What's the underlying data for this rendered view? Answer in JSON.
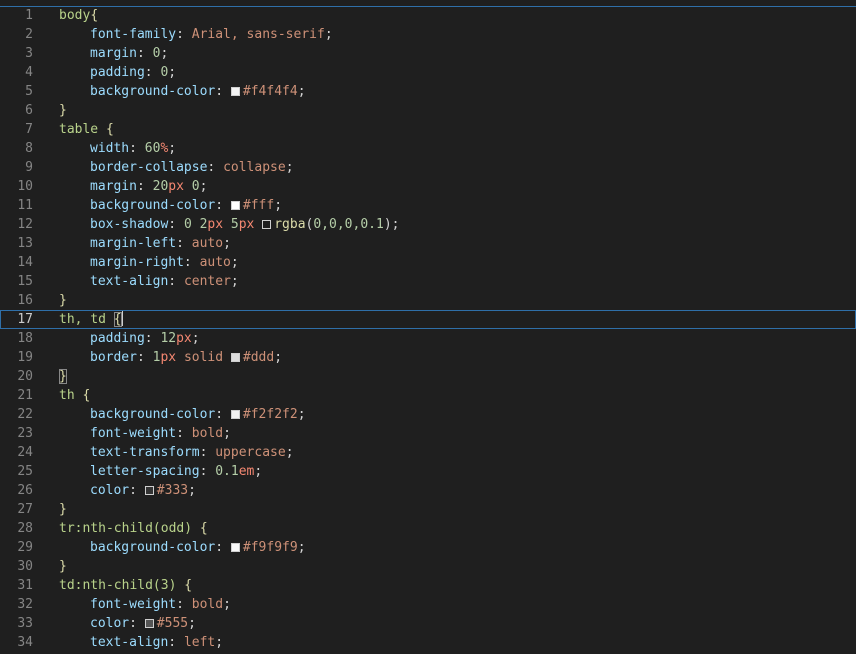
{
  "editor": {
    "current_line": 17,
    "lines": [
      {
        "n": "1",
        "indent": false,
        "tokens": [
          {
            "t": "body",
            "c": "sel"
          },
          {
            "t": "{",
            "c": "brace"
          }
        ]
      },
      {
        "n": "2",
        "indent": true,
        "tokens": [
          {
            "t": "font-family",
            "c": "prop"
          },
          {
            "t": ": ",
            "c": "plain"
          },
          {
            "t": "Arial, sans-serif",
            "c": "val"
          },
          {
            "t": ";",
            "c": "plain"
          }
        ]
      },
      {
        "n": "3",
        "indent": true,
        "tokens": [
          {
            "t": "margin",
            "c": "prop"
          },
          {
            "t": ": ",
            "c": "plain"
          },
          {
            "t": "0",
            "c": "num-v"
          },
          {
            "t": ";",
            "c": "plain"
          }
        ]
      },
      {
        "n": "4",
        "indent": true,
        "tokens": [
          {
            "t": "padding",
            "c": "prop"
          },
          {
            "t": ": ",
            "c": "plain"
          },
          {
            "t": "0",
            "c": "num-v"
          },
          {
            "t": ";",
            "c": "plain"
          }
        ]
      },
      {
        "n": "5",
        "indent": true,
        "tokens": [
          {
            "t": "background-color",
            "c": "prop"
          },
          {
            "t": ": ",
            "c": "plain"
          },
          {
            "t": "#f4f4f4",
            "c": "hexv",
            "swatch": "#f4f4f4"
          },
          {
            "t": ";",
            "c": "plain"
          }
        ]
      },
      {
        "n": "6",
        "indent": false,
        "tokens": [
          {
            "t": "}",
            "c": "brace"
          }
        ]
      },
      {
        "n": "7",
        "indent": false,
        "tokens": [
          {
            "t": "table ",
            "c": "sel"
          },
          {
            "t": "{",
            "c": "brace"
          }
        ]
      },
      {
        "n": "8",
        "indent": true,
        "tokens": [
          {
            "t": "width",
            "c": "prop"
          },
          {
            "t": ": ",
            "c": "plain"
          },
          {
            "t": "60",
            "c": "num-v"
          },
          {
            "t": "%",
            "c": "unit"
          },
          {
            "t": ";",
            "c": "plain"
          }
        ]
      },
      {
        "n": "9",
        "indent": true,
        "tokens": [
          {
            "t": "border-collapse",
            "c": "prop"
          },
          {
            "t": ": ",
            "c": "plain"
          },
          {
            "t": "collapse",
            "c": "val"
          },
          {
            "t": ";",
            "c": "plain"
          }
        ]
      },
      {
        "n": "10",
        "indent": true,
        "tokens": [
          {
            "t": "margin",
            "c": "prop"
          },
          {
            "t": ": ",
            "c": "plain"
          },
          {
            "t": "20",
            "c": "num-v"
          },
          {
            "t": "px",
            "c": "unit"
          },
          {
            "t": " ",
            "c": "plain"
          },
          {
            "t": "0",
            "c": "num-v"
          },
          {
            "t": ";",
            "c": "plain"
          }
        ]
      },
      {
        "n": "11",
        "indent": true,
        "tokens": [
          {
            "t": "background-color",
            "c": "prop"
          },
          {
            "t": ": ",
            "c": "plain"
          },
          {
            "t": "#fff",
            "c": "hexv",
            "swatch": "#ffffff"
          },
          {
            "t": ";",
            "c": "plain"
          }
        ]
      },
      {
        "n": "12",
        "indent": true,
        "tokens": [
          {
            "t": "box-shadow",
            "c": "prop"
          },
          {
            "t": ": ",
            "c": "plain"
          },
          {
            "t": "0",
            "c": "num-v"
          },
          {
            "t": " ",
            "c": "plain"
          },
          {
            "t": "2",
            "c": "num-v"
          },
          {
            "t": "px",
            "c": "unit"
          },
          {
            "t": " ",
            "c": "plain"
          },
          {
            "t": "5",
            "c": "num-v"
          },
          {
            "t": "px",
            "c": "unit"
          },
          {
            "t": " ",
            "c": "plain"
          },
          {
            "t": "rgba",
            "c": "brace",
            "swatch": "#1f1f1f"
          },
          {
            "t": "(",
            "c": "plain"
          },
          {
            "t": "0,0,0,0.1",
            "c": "num-v"
          },
          {
            "t": ");",
            "c": "plain"
          }
        ]
      },
      {
        "n": "13",
        "indent": true,
        "tokens": [
          {
            "t": "margin-left",
            "c": "prop"
          },
          {
            "t": ": ",
            "c": "plain"
          },
          {
            "t": "auto",
            "c": "val"
          },
          {
            "t": ";",
            "c": "plain"
          }
        ]
      },
      {
        "n": "14",
        "indent": true,
        "tokens": [
          {
            "t": "margin-right",
            "c": "prop"
          },
          {
            "t": ": ",
            "c": "plain"
          },
          {
            "t": "auto",
            "c": "val"
          },
          {
            "t": ";",
            "c": "plain"
          }
        ]
      },
      {
        "n": "15",
        "indent": true,
        "tokens": [
          {
            "t": "text-align",
            "c": "prop"
          },
          {
            "t": ": ",
            "c": "plain"
          },
          {
            "t": "center",
            "c": "val"
          },
          {
            "t": ";",
            "c": "plain"
          }
        ]
      },
      {
        "n": "16",
        "indent": false,
        "tokens": [
          {
            "t": "}",
            "c": "brace"
          }
        ]
      },
      {
        "n": "17",
        "indent": false,
        "tokens": [
          {
            "t": "th, td ",
            "c": "sel"
          },
          {
            "t": "{",
            "c": "brace",
            "hl": true
          }
        ]
      },
      {
        "n": "18",
        "indent": true,
        "tokens": [
          {
            "t": "padding",
            "c": "prop"
          },
          {
            "t": ": ",
            "c": "plain"
          },
          {
            "t": "12",
            "c": "num-v"
          },
          {
            "t": "px",
            "c": "unit"
          },
          {
            "t": ";",
            "c": "plain"
          }
        ]
      },
      {
        "n": "19",
        "indent": true,
        "tokens": [
          {
            "t": "border",
            "c": "prop"
          },
          {
            "t": ": ",
            "c": "plain"
          },
          {
            "t": "1",
            "c": "num-v"
          },
          {
            "t": "px",
            "c": "unit"
          },
          {
            "t": " ",
            "c": "plain"
          },
          {
            "t": "solid",
            "c": "val"
          },
          {
            "t": " ",
            "c": "plain"
          },
          {
            "t": "#ddd",
            "c": "hexv",
            "swatch": "#dddddd"
          },
          {
            "t": ";",
            "c": "plain"
          }
        ]
      },
      {
        "n": "20",
        "indent": false,
        "tokens": [
          {
            "t": "}",
            "c": "brace",
            "hl": true
          }
        ]
      },
      {
        "n": "21",
        "indent": false,
        "tokens": [
          {
            "t": "th ",
            "c": "sel"
          },
          {
            "t": "{",
            "c": "brace"
          }
        ]
      },
      {
        "n": "22",
        "indent": true,
        "tokens": [
          {
            "t": "background-color",
            "c": "prop"
          },
          {
            "t": ": ",
            "c": "plain"
          },
          {
            "t": "#f2f2f2",
            "c": "hexv",
            "swatch": "#f2f2f2"
          },
          {
            "t": ";",
            "c": "plain"
          }
        ]
      },
      {
        "n": "23",
        "indent": true,
        "tokens": [
          {
            "t": "font-weight",
            "c": "prop"
          },
          {
            "t": ": ",
            "c": "plain"
          },
          {
            "t": "bold",
            "c": "val"
          },
          {
            "t": ";",
            "c": "plain"
          }
        ]
      },
      {
        "n": "24",
        "indent": true,
        "tokens": [
          {
            "t": "text-transform",
            "c": "prop"
          },
          {
            "t": ": ",
            "c": "plain"
          },
          {
            "t": "uppercase",
            "c": "val"
          },
          {
            "t": ";",
            "c": "plain"
          }
        ]
      },
      {
        "n": "25",
        "indent": true,
        "tokens": [
          {
            "t": "letter-spacing",
            "c": "prop"
          },
          {
            "t": ": ",
            "c": "plain"
          },
          {
            "t": "0.1",
            "c": "num-v"
          },
          {
            "t": "em",
            "c": "unit"
          },
          {
            "t": ";",
            "c": "plain"
          }
        ]
      },
      {
        "n": "26",
        "indent": true,
        "tokens": [
          {
            "t": "color",
            "c": "prop"
          },
          {
            "t": ": ",
            "c": "plain"
          },
          {
            "t": "#333",
            "c": "hexv",
            "swatch": "#333333"
          },
          {
            "t": ";",
            "c": "plain"
          }
        ]
      },
      {
        "n": "27",
        "indent": false,
        "tokens": [
          {
            "t": "}",
            "c": "brace"
          }
        ]
      },
      {
        "n": "28",
        "indent": false,
        "tokens": [
          {
            "t": "tr:nth-child(odd) ",
            "c": "sel"
          },
          {
            "t": "{",
            "c": "brace"
          }
        ]
      },
      {
        "n": "29",
        "indent": true,
        "tokens": [
          {
            "t": "background-color",
            "c": "prop"
          },
          {
            "t": ": ",
            "c": "plain"
          },
          {
            "t": "#f9f9f9",
            "c": "hexv",
            "swatch": "#f9f9f9"
          },
          {
            "t": ";",
            "c": "plain"
          }
        ]
      },
      {
        "n": "30",
        "indent": false,
        "tokens": [
          {
            "t": "}",
            "c": "brace"
          }
        ]
      },
      {
        "n": "31",
        "indent": false,
        "tokens": [
          {
            "t": "td:nth-child(3) ",
            "c": "sel"
          },
          {
            "t": "{",
            "c": "brace"
          }
        ]
      },
      {
        "n": "32",
        "indent": true,
        "tokens": [
          {
            "t": "font-weight",
            "c": "prop"
          },
          {
            "t": ": ",
            "c": "plain"
          },
          {
            "t": "bold",
            "c": "val"
          },
          {
            "t": ";",
            "c": "plain"
          }
        ]
      },
      {
        "n": "33",
        "indent": true,
        "tokens": [
          {
            "t": "color",
            "c": "prop"
          },
          {
            "t": ": ",
            "c": "plain"
          },
          {
            "t": "#555",
            "c": "hexv",
            "swatch": "#555555"
          },
          {
            "t": ";",
            "c": "plain"
          }
        ]
      },
      {
        "n": "34",
        "indent": true,
        "tokens": [
          {
            "t": "text-align",
            "c": "prop"
          },
          {
            "t": ": ",
            "c": "plain"
          },
          {
            "t": "left",
            "c": "val"
          },
          {
            "t": ";",
            "c": "plain"
          }
        ]
      }
    ]
  },
  "colors": {
    "background": "#1f1f1f",
    "line_number": "#858585",
    "current_line_border": "#2f6fa8",
    "selector": "#b9d38b",
    "property": "#9cdcfe",
    "value": "#ce9178",
    "number": "#b5cea8",
    "unit": "#f48771",
    "brace": "#dcdcaa"
  }
}
